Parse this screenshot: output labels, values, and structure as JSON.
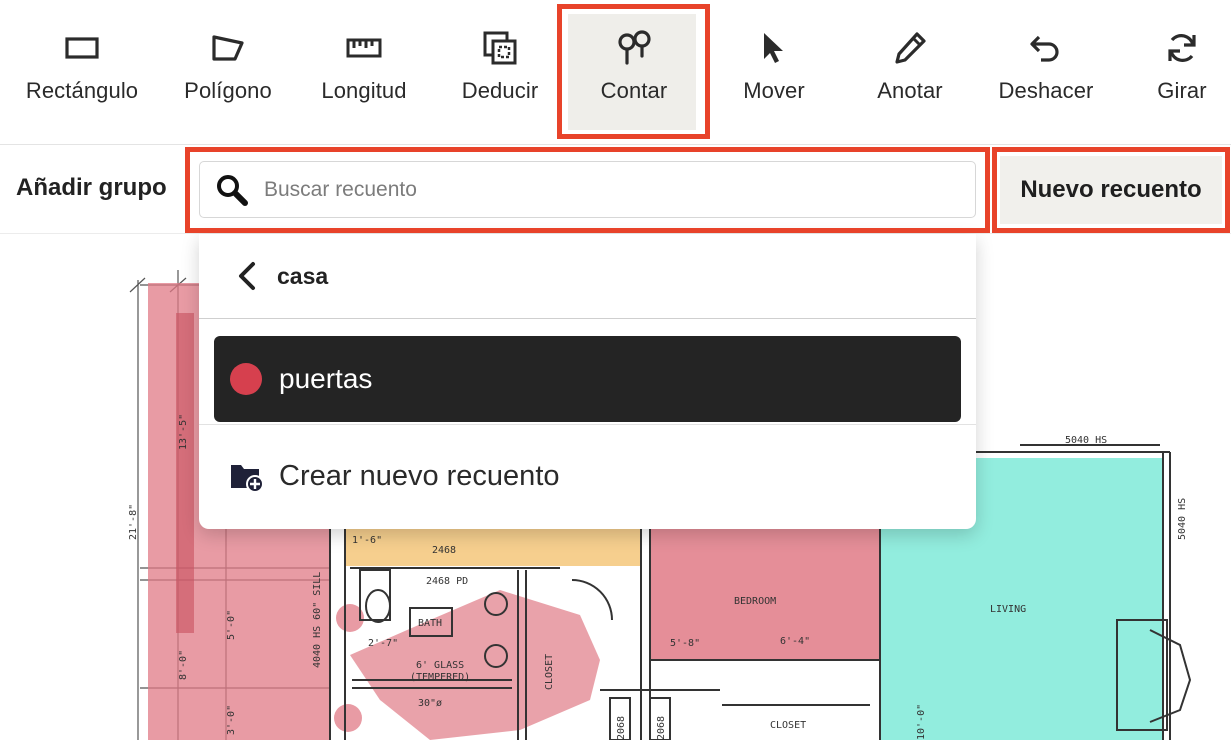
{
  "toolbar": {
    "tools": [
      {
        "label": "Rectángulo",
        "icon": "rectangle-icon"
      },
      {
        "label": "Polígono",
        "icon": "polygon-icon"
      },
      {
        "label": "Longitud",
        "icon": "ruler-icon"
      },
      {
        "label": "Deducir",
        "icon": "deduct-icon"
      },
      {
        "label": "Contar",
        "icon": "count-pins-icon",
        "active": true
      },
      {
        "label": "Mover",
        "icon": "cursor-arrow-icon"
      },
      {
        "label": "Anotar",
        "icon": "pen-icon"
      },
      {
        "label": "Deshacer",
        "icon": "undo-icon"
      },
      {
        "label": "Girar",
        "icon": "rotate-icon"
      }
    ]
  },
  "subbar": {
    "add_group": "Añadir grupo",
    "search_placeholder": "Buscar recuento",
    "search_value": "",
    "new_count": "Nuevo recuento"
  },
  "dropdown": {
    "back_label": "casa",
    "items": [
      {
        "label": "puertas",
        "color": "#d6404e"
      }
    ],
    "create_label": "Crear nuevo recuento"
  },
  "plan_labels": {
    "window_top": "5040 HS",
    "window_right": "5040 HS",
    "bedroom": "BEDROOM",
    "living": "LIVING",
    "bath": "BATH",
    "closet": "CLOSET",
    "closet2": "CLOSET",
    "door1": "2468",
    "door2": "2468 PD",
    "glass1": "6' GLASS",
    "glass2": "(TEMPERED)",
    "dim_30": "30\"ø",
    "dim_left1": "21'-8\"",
    "dim_left2": "13'-5\"",
    "dim_left3": "8'-0\"",
    "dim_left4": "5'-0\"",
    "dim_left5": "3'-0\"",
    "dim_bed1": "5'-8\"",
    "dim_bed2": "6'-4\"",
    "dim_mid1": "2'-7\"",
    "dim_mid2": "1'-6\"",
    "win_side": "4040 HS 60\" SILL",
    "door_v1": "2068",
    "door_v2": "2068",
    "dim_liv": "10'-0\""
  },
  "colors": {
    "highlight": "#e8432a",
    "red_area": "#e07a86",
    "teal_area": "#7fead8",
    "yellow_area": "#f4c77a"
  }
}
